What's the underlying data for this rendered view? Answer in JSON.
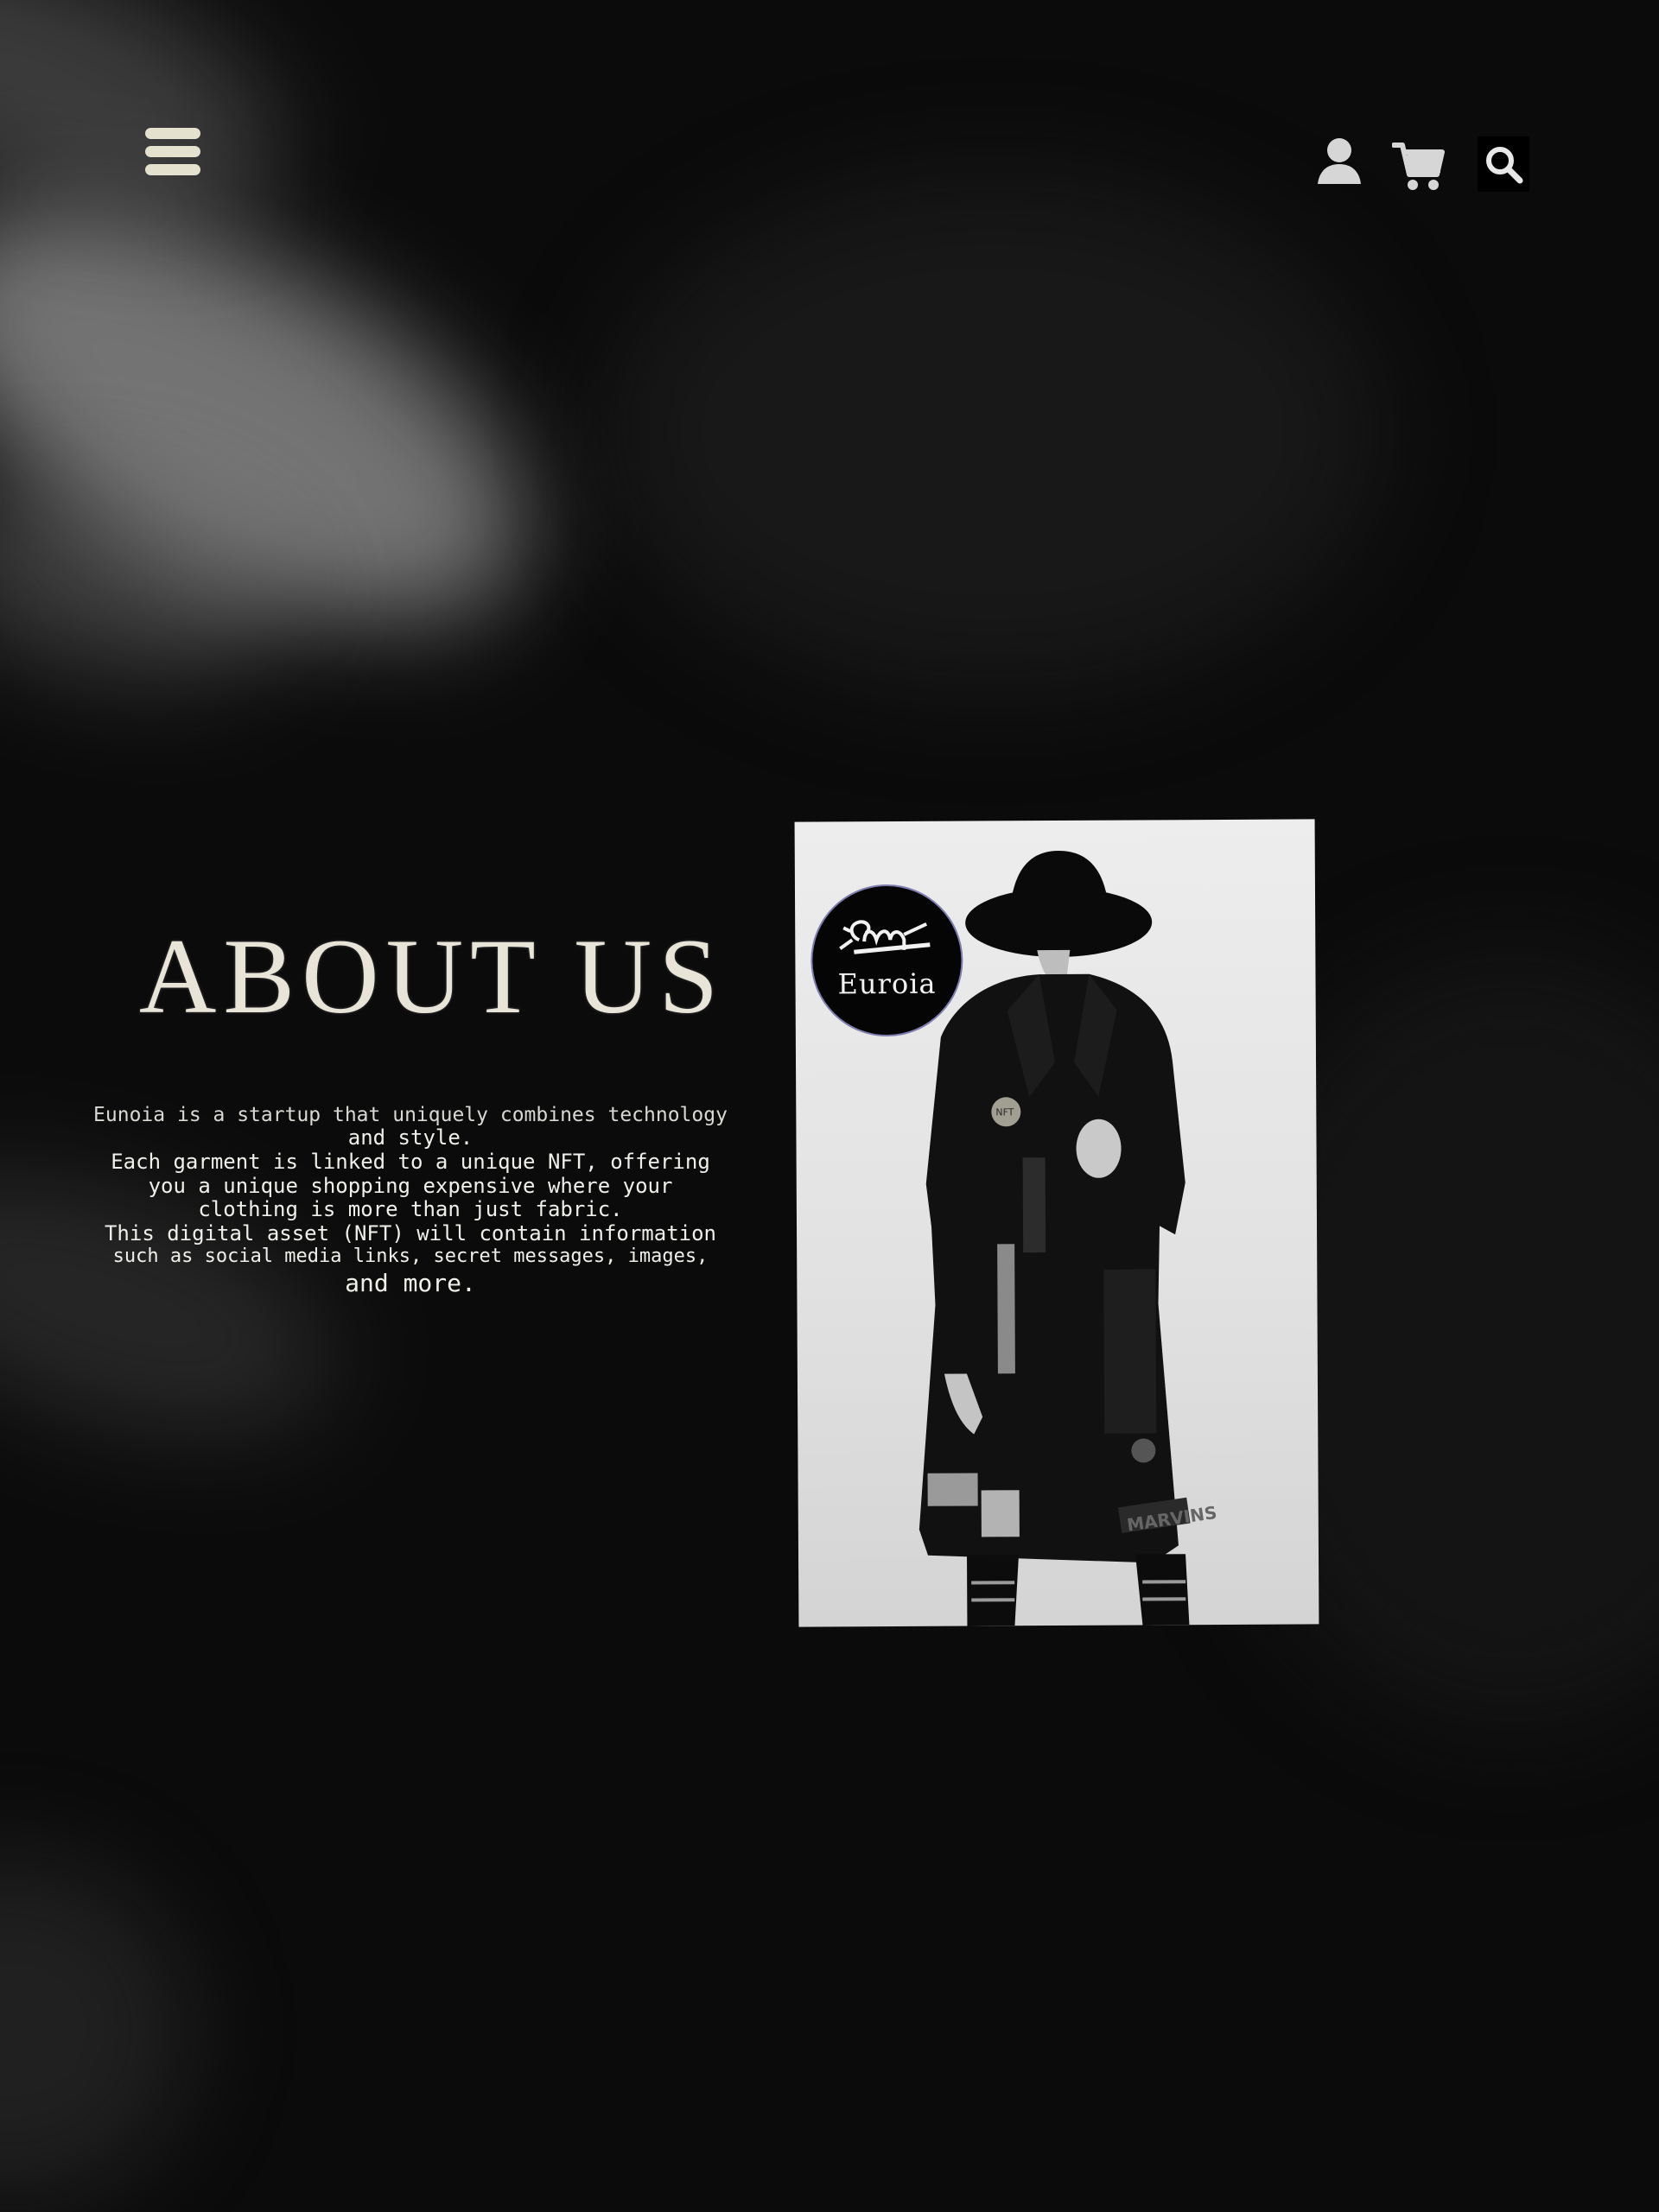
{
  "header": {
    "menu_icon": "hamburger-menu-icon",
    "user_icon": "user-icon",
    "cart_icon": "shopping-cart-icon",
    "search_icon": "search-icon"
  },
  "about": {
    "title": "ABOUT US",
    "lines": [
      "Eunoia is a startup that uniquely combines technology",
      "and style.",
      "Each garment is linked to a unique NFT, offering",
      "you a unique shopping expensive where your",
      "clothing is more than just fabric.",
      "This digital asset (NFT) will contain information",
      "such as social media links, secret messages, images,",
      "and more."
    ]
  },
  "photo": {
    "logo_text": "Euroia",
    "pin_text": "NFT",
    "patch_text": "MARVINS"
  },
  "colors": {
    "background": "#0b0b0b",
    "icon_color": "#e4e1cf",
    "text_color": "#f0f0ea"
  }
}
